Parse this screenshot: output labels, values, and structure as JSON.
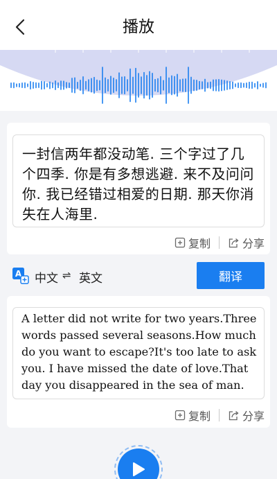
{
  "header": {
    "title": "播放"
  },
  "source": {
    "text": "一封信两年都没动笔. 三个字过了几个四季. 你是有多想逃避. 来不及问问你. 我已经错过相爱的日期. 那天你消失在人海里.",
    "copy_label": "复制",
    "share_label": "分享"
  },
  "language": {
    "from": "中文",
    "swap_symbol": "⇌",
    "to": "英文",
    "translate_label": "翻译"
  },
  "result": {
    "text": "A letter did not write for two years.Three words passed several seasons.How much do you want to escape?It's too late to ask you. I have missed the date of love.That day you disappeared in the sea of man.",
    "copy_label": "复制",
    "share_label": "分享"
  },
  "colors": {
    "accent": "#1a7ef0",
    "wave_bg": "#d6d9f3"
  }
}
